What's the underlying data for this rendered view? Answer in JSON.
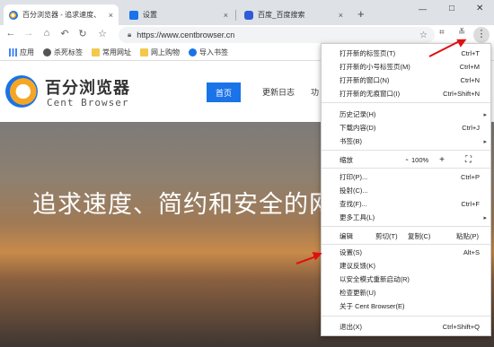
{
  "tabs": [
    {
      "label": "百分浏览器 - 追求速度、",
      "active": true
    },
    {
      "label": "设置",
      "active": false
    },
    {
      "label": "百度_百度搜索",
      "active": false
    }
  ],
  "new_tab_symbol": "+",
  "close_symbol": "×",
  "window_controls": {
    "minimize": "—",
    "maximize": "□",
    "close": "✕"
  },
  "url": "https://www.centbrowser.cn",
  "bookmarks": [
    {
      "label": "应用",
      "icon": "apps-grid-icon"
    },
    {
      "label": "杀死标签",
      "icon": "kill-tab-icon"
    },
    {
      "label": "常用网址",
      "icon": "folder-icon"
    },
    {
      "label": "网上购物",
      "icon": "folder-icon"
    },
    {
      "label": "导入书签",
      "icon": "gear-icon"
    }
  ],
  "site": {
    "logo_cn": "百分浏览器",
    "logo_en": "Cent Browser",
    "nav": [
      "首页",
      "更新日志",
      "功"
    ],
    "hero_title": "追求速度、简约和安全的网"
  },
  "menu": {
    "new_tab": {
      "label": "打开新的标签页(T)",
      "shortcut": "Ctrl+T"
    },
    "new_small_tab": {
      "label": "打开新的小号标签页(M)",
      "shortcut": "Ctrl+M"
    },
    "new_window": {
      "label": "打开新的窗口(N)",
      "shortcut": "Ctrl+N"
    },
    "incognito": {
      "label": "打开新的无痕窗口(I)",
      "shortcut": "Ctrl+Shift+N"
    },
    "history": {
      "label": "历史记录(H)",
      "shortcut": ""
    },
    "downloads": {
      "label": "下载内容(D)",
      "shortcut": "Ctrl+J"
    },
    "bookmarks": {
      "label": "书签(B)",
      "shortcut": ""
    },
    "zoom": {
      "label": "缩放",
      "minus": "-",
      "value": "100%",
      "plus": "+"
    },
    "print": {
      "label": "打印(P)...",
      "shortcut": "Ctrl+P"
    },
    "cast": {
      "label": "投射(C)...",
      "shortcut": ""
    },
    "find": {
      "label": "查找(F)...",
      "shortcut": "Ctrl+F"
    },
    "more_tools": {
      "label": "更多工具(L)",
      "shortcut": ""
    },
    "edit": {
      "label": "编辑",
      "cut": "剪切(T)",
      "copy": "复制(C)",
      "paste": "粘贴(P)"
    },
    "settings": {
      "label": "设置(S)",
      "shortcut": "Alt+S"
    },
    "feedback": {
      "label": "建议反馈(K)",
      "shortcut": ""
    },
    "safe_restart": {
      "label": "以安全模式重新启动(R)",
      "shortcut": ""
    },
    "check_update": {
      "label": "检查更新(U)",
      "shortcut": ""
    },
    "about": {
      "label": "关于 Cent Browser(E)",
      "shortcut": ""
    },
    "exit": {
      "label": "退出(X)",
      "shortcut": "Ctrl+Shift+Q"
    }
  },
  "colors": {
    "accent": "#1a73e8",
    "annotation_arrow": "#e01010"
  }
}
